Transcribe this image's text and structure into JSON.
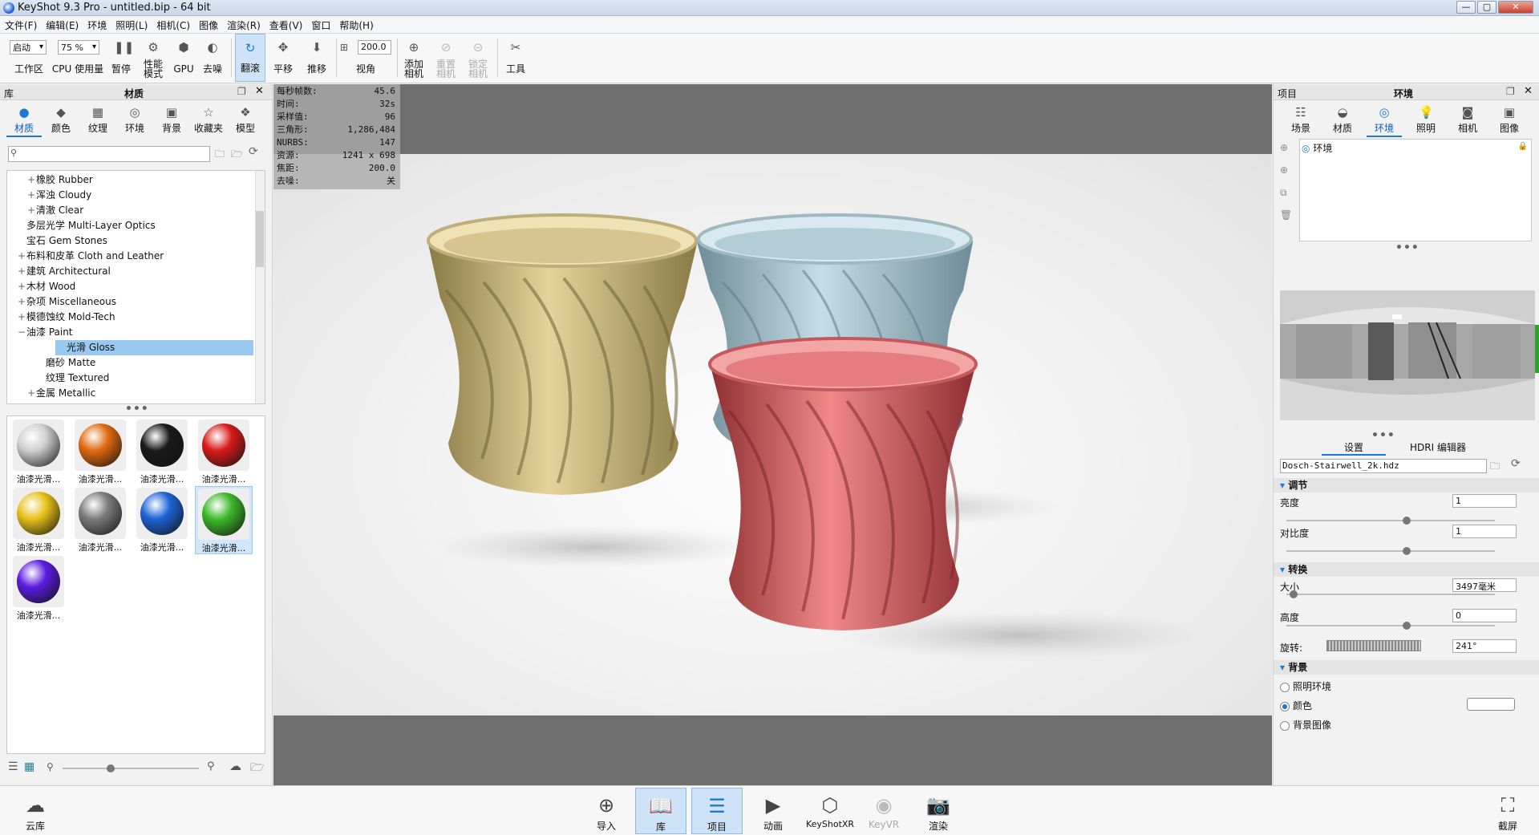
{
  "window": {
    "title": "KeyShot 9.3 Pro  - untitled.bip  - 64 bit",
    "min": "—",
    "max": "▢",
    "close": "✕"
  },
  "menu": [
    "文件(F)",
    "编辑(E)",
    "环境",
    "照明(L)",
    "相机(C)",
    "图像",
    "渲染(R)",
    "查看(V)",
    "窗口",
    "帮助(H)"
  ],
  "toolbar": {
    "mode_value": "启动",
    "cpu_value": "75 %",
    "workspace": "工作区",
    "cpu_usage": "CPU 使用量",
    "pause": "暂停",
    "perf_mode": "性能\n模式",
    "gpu": "GPU",
    "denoise": "去噪",
    "tumble": "翻滚",
    "pan": "平移",
    "dolly": "推移",
    "fov_value": "200.0",
    "fov": "视角",
    "add_camera": "添加\n相机",
    "reset_camera": "重置\n相机",
    "lock_camera": "锁定\n相机",
    "tools": "工具"
  },
  "library": {
    "panel_label": "库",
    "panel_title": "材质",
    "tabs": [
      "材质",
      "颜色",
      "纹理",
      "环境",
      "背景",
      "收藏夹",
      "模型"
    ],
    "search_placeholder": "",
    "tree": [
      {
        "pm": "+",
        "indent": 2,
        "label": "橡胶 Rubber"
      },
      {
        "pm": "+",
        "indent": 2,
        "label": "浑浊 Cloudy"
      },
      {
        "pm": "+",
        "indent": 2,
        "label": "清澈 Clear"
      },
      {
        "pm": "",
        "indent": 1,
        "label": "多层光学 Multi-Layer Optics"
      },
      {
        "pm": "",
        "indent": 1,
        "label": "宝石 Gem Stones"
      },
      {
        "pm": "+",
        "indent": 1,
        "label": "布料和皮革 Cloth and Leather"
      },
      {
        "pm": "+",
        "indent": 1,
        "label": "建筑 Architectural"
      },
      {
        "pm": "+",
        "indent": 1,
        "label": "木材 Wood"
      },
      {
        "pm": "+",
        "indent": 1,
        "label": "杂项 Miscellaneous"
      },
      {
        "pm": "+",
        "indent": 1,
        "label": "模德蚀纹 Mold-Tech"
      },
      {
        "pm": "−",
        "indent": 1,
        "label": "油漆 Paint"
      },
      {
        "pm": "",
        "indent": 3,
        "label": "光滑 Gloss",
        "selected": true
      },
      {
        "pm": "",
        "indent": 3,
        "label": "磨砂 Matte"
      },
      {
        "pm": "",
        "indent": 3,
        "label": "纹理 Textured"
      },
      {
        "pm": "+",
        "indent": 2,
        "label": "金属 Metallic"
      }
    ],
    "swatches": [
      {
        "label": "油漆光滑...",
        "color": "#cfcfcf"
      },
      {
        "label": "油漆光滑...",
        "color": "#e06a10"
      },
      {
        "label": "油漆光滑...",
        "color": "#1a1a1a"
      },
      {
        "label": "油漆光滑...",
        "color": "#d81a1a"
      },
      {
        "label": "油漆光滑...",
        "color": "#e7c21a"
      },
      {
        "label": "油漆光滑...",
        "color": "#7c7c7c"
      },
      {
        "label": "油漆光滑...",
        "color": "#1e63d6"
      },
      {
        "label": "油漆光滑...",
        "color": "#3cb82a",
        "selected": true
      },
      {
        "label": "油漆光滑...",
        "color": "#5a1be0"
      }
    ]
  },
  "hud": [
    {
      "k": "每秒帧数:",
      "v": "45.6"
    },
    {
      "k": "时间:",
      "v": "32s"
    },
    {
      "k": "采样值:",
      "v": "96"
    },
    {
      "k": "三角形:",
      "v": "1,286,484"
    },
    {
      "k": "NURBS:",
      "v": "147"
    },
    {
      "k": "资源:",
      "v": "1241 x 698"
    },
    {
      "k": "焦距:",
      "v": "200.0"
    },
    {
      "k": "去噪:",
      "v": "关"
    }
  ],
  "project": {
    "panel_label": "项目",
    "panel_title": "环境",
    "tabs": [
      "场景",
      "材质",
      "环境",
      "照明",
      "相机",
      "图像"
    ],
    "env_item": "环境",
    "subtabs": [
      "设置",
      "HDRI 编辑器"
    ],
    "hdr_file": "Dosch-Stairwell_2k.hdz",
    "sections": {
      "adjust": "调节",
      "transform": "转换",
      "background": "背景"
    },
    "brightness_label": "亮度",
    "brightness": "1",
    "contrast_label": "对比度",
    "contrast": "1",
    "size_label": "大小",
    "size": "3497毫米",
    "height_label": "高度",
    "height": "0",
    "rotation_label": "旋转:",
    "rotation": "241°",
    "bg_options": [
      "照明环境",
      "颜色",
      "背景图像"
    ],
    "bg_selected": 1
  },
  "bottom": [
    "云库",
    "导入",
    "库",
    "项目",
    "动画",
    "KeyShotXR",
    "KeyVR",
    "渲染",
    "截屏"
  ]
}
